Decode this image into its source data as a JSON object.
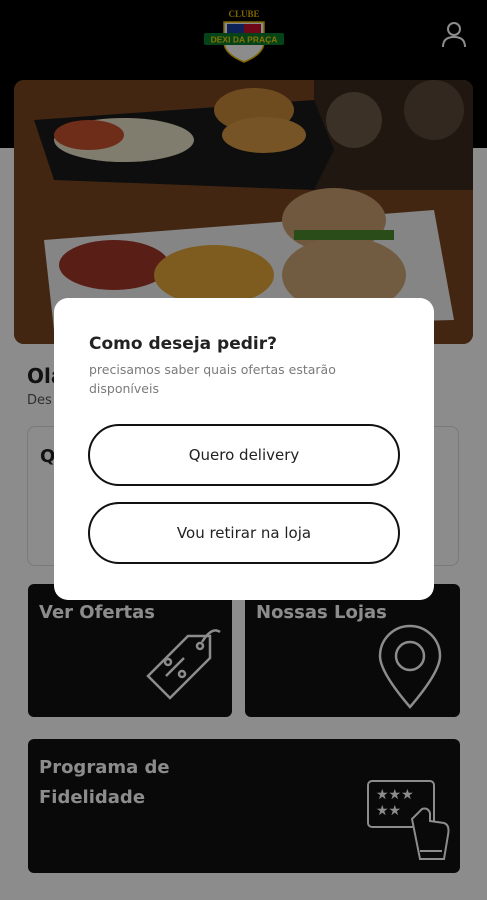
{
  "header": {
    "logo_top": "CLUBE",
    "logo_bottom": "DEXI DA PRAÇA",
    "logo_icon": "club-shield-logo",
    "user_icon": "user-icon"
  },
  "hero": {
    "image": "food-photo-burgers-fries"
  },
  "greeting": {
    "title": "Olá",
    "subtitle": "Des"
  },
  "ghost_card": {
    "title": "Q d"
  },
  "cards": {
    "offers": {
      "label": "Ver Ofertas",
      "icon": "price-tag-percent-icon"
    },
    "stores": {
      "label": "Nossas Lojas",
      "icon": "location-pin-icon"
    },
    "loyalty": {
      "label": "Programa de Fidelidade",
      "icon": "loyalty-card-icon"
    }
  },
  "modal": {
    "title": "Como deseja pedir?",
    "subtitle": "precisamos saber quais ofertas estarão disponíveis",
    "option_delivery": "Quero delivery",
    "option_pickup": "Vou retirar na loja"
  },
  "colors": {
    "background_dark": "#000000",
    "card": "#111111",
    "modal": "#ffffff",
    "overlay": "rgba(0,0,0,0.45)"
  }
}
